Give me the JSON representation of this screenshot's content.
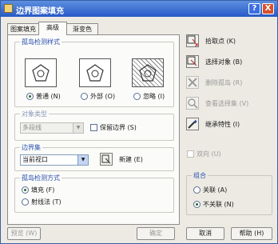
{
  "window": {
    "title": "边界图案填充"
  },
  "titlebar_buttons": {
    "help": "?",
    "close": "X"
  },
  "tabs": [
    {
      "label": "图案填充"
    },
    {
      "label": "高级",
      "active": true
    },
    {
      "label": "渐变色"
    }
  ],
  "island_style": {
    "title": "孤岛检测样式",
    "options": [
      {
        "label": "普通 (N)",
        "selected": true
      },
      {
        "label": "外部 (O)",
        "selected": false
      },
      {
        "label": "忽略 (I)",
        "selected": false
      }
    ]
  },
  "object_type": {
    "title": "对象类型",
    "select_value": "多段线",
    "retain_boundaries_label": "保留边界 (S)",
    "retain_boundaries_checked": false
  },
  "boundary_set": {
    "title": "边界集",
    "select_value": "当前视口",
    "new_label": "新建 (E)"
  },
  "island_detection": {
    "title": "孤岛检测方式",
    "options": [
      {
        "label": "填充 (F)",
        "selected": true
      },
      {
        "label": "射线法 (T)",
        "selected": false
      }
    ]
  },
  "actions": [
    {
      "label": "拾取点 (K)",
      "icon": "pick-points-icon",
      "enabled": true
    },
    {
      "label": "选择对象 (B)",
      "icon": "select-objects-icon",
      "enabled": true
    },
    {
      "label": "删除孤岛 (R)",
      "icon": "remove-islands-icon",
      "enabled": false
    },
    {
      "label": "查看选择集 (V)",
      "icon": "view-selections-icon",
      "enabled": false
    },
    {
      "label": "继承特性 (I)",
      "icon": "inherit-properties-icon",
      "enabled": true
    }
  ],
  "double_label": "双向 (U)",
  "composition": {
    "title": "组合",
    "options": [
      {
        "label": "关联 (A)",
        "selected": false
      },
      {
        "label": "不关联 (N)",
        "selected": true
      }
    ]
  },
  "buttons": {
    "preview": "预览 (W)",
    "ok": "确定",
    "cancel": "取消",
    "help": "帮助 (H)"
  }
}
